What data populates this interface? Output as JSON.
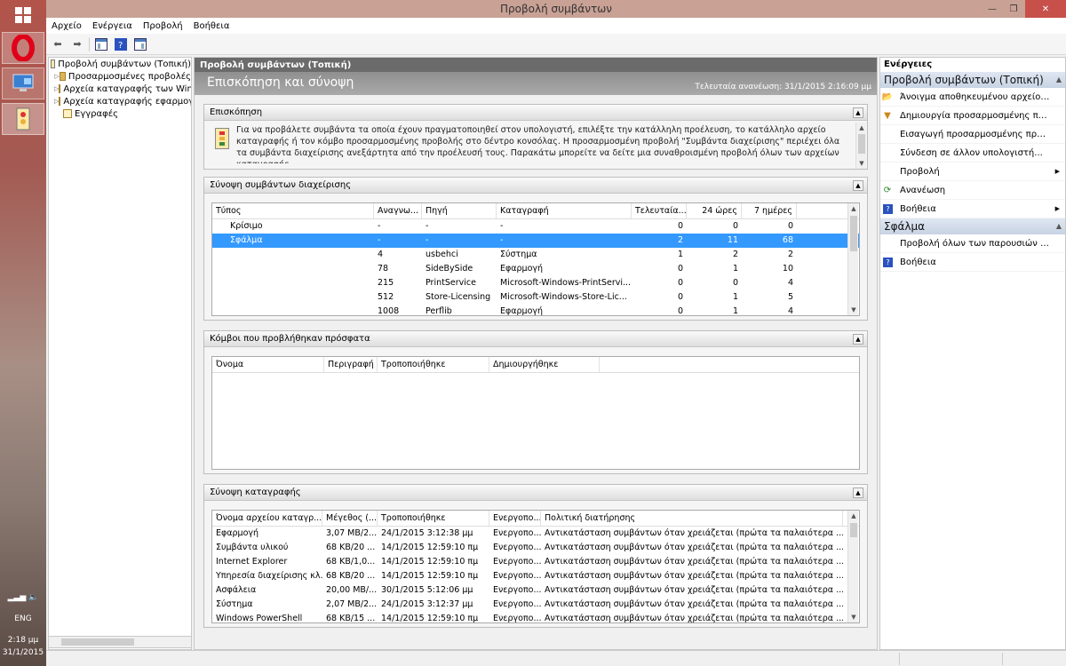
{
  "window": {
    "title": "Προβολή συμβάντων",
    "minimize": "—",
    "restore": "❐",
    "close": "✕"
  },
  "menu": [
    "Αρχείο",
    "Ενέργεια",
    "Προβολή",
    "Βοήθεια"
  ],
  "taskbar": {
    "language": "ENG",
    "time": "2:18 μμ",
    "date": "31/1/2015"
  },
  "tree": [
    {
      "label": "Προβολή συμβάντων (Τοπική)",
      "expander": ""
    },
    {
      "label": "Προσαρμοσμένες προβολές",
      "expander": "▷"
    },
    {
      "label": "Αρχεία καταγραφής των Windows",
      "expander": "▷"
    },
    {
      "label": "Αρχεία καταγραφής εφαρμογών",
      "expander": "▷"
    },
    {
      "label": "Εγγραφές",
      "expander": ""
    }
  ],
  "center": {
    "header": "Προβολή συμβάντων (Τοπική)",
    "banner_title": "Επισκόπηση και σύνοψη",
    "last_update": "Τελευταία ανανέωση: 31/1/2015 2:16:09 μμ",
    "overview": {
      "title": "Επισκόπηση",
      "text": "Για να προβάλετε συμβάντα τα οποία έχουν πραγματοποιηθεί στον υπολογιστή, επιλέξτε την κατάλληλη προέλευση, το κατάλληλο αρχείο καταγραφής ή τον κόμβο προσαρμοσμένης προβολής στο δέντρο κονσόλας. Η προσαρμοσμένη προβολή \"Συμβάντα διαχείρισης\" περιέχει όλα τα συμβάντα διαχείρισης ανεξάρτητα από την προέλευσή τους. Παρακάτω μπορείτε να δείτε μια συναθροισμένη προβολή όλων των αρχείων καταγραφής."
    },
    "summary": {
      "title": "Σύνοψη συμβάντων διαχείρισης",
      "columns": [
        "Τύπος",
        "Αναγνω...",
        "Πηγή",
        "Καταγραφή",
        "Τελευταία...",
        "24 ώρες",
        "7 ημέρες"
      ],
      "rows": [
        {
          "type": "Κρίσιμο",
          "id": "-",
          "source": "-",
          "log": "-",
          "hour": "0",
          "day": "0",
          "week": "0"
        },
        {
          "type": "Σφάλμα",
          "id": "-",
          "source": "-",
          "log": "-",
          "hour": "2",
          "day": "11",
          "week": "68"
        },
        {
          "type": "",
          "id": "4",
          "source": "usbehci",
          "log": "Σύστημα",
          "hour": "1",
          "day": "2",
          "week": "2"
        },
        {
          "type": "",
          "id": "78",
          "source": "SideBySide",
          "log": "Εφαρμογή",
          "hour": "0",
          "day": "1",
          "week": "10"
        },
        {
          "type": "",
          "id": "215",
          "source": "PrintService",
          "log": "Microsoft-Windows-PrintServi...",
          "hour": "0",
          "day": "0",
          "week": "4"
        },
        {
          "type": "",
          "id": "512",
          "source": "Store-Licensing",
          "log": "Microsoft-Windows-Store-Lic...",
          "hour": "0",
          "day": "1",
          "week": "5"
        },
        {
          "type": "",
          "id": "1008",
          "source": "Perflib",
          "log": "Εφαρμογή",
          "hour": "0",
          "day": "1",
          "week": "4"
        }
      ]
    },
    "recent": {
      "title": "Κόμβοι που προβλήθηκαν πρόσφατα",
      "columns": [
        "Όνομα",
        "Περιγραφή",
        "Τροποποιήθηκε",
        "Δημιουργήθηκε"
      ]
    },
    "logsum": {
      "title": "Σύνοψη καταγραφής",
      "columns": [
        "Όνομα αρχείου καταγρ...",
        "Μέγεθος (...",
        "Τροποποιήθηκε",
        "Ενεργοπο...",
        "Πολιτική διατήρησης"
      ],
      "rows": [
        {
          "name": "Εφαρμογή",
          "size": "3,07 MB/2...",
          "mod": "24/1/2015 3:12:38 μμ",
          "en": "Ενεργοπο...",
          "pol": "Αντικατάσταση συμβάντων όταν χρειάζεται (πρώτα τα παλαιότερα ..."
        },
        {
          "name": "Συμβάντα υλικού",
          "size": "68 KB/20 ...",
          "mod": "14/1/2015 12:59:10 πμ",
          "en": "Ενεργοπο...",
          "pol": "Αντικατάσταση συμβάντων όταν χρειάζεται (πρώτα τα παλαιότερα ..."
        },
        {
          "name": "Internet Explorer",
          "size": "68 KB/1,0...",
          "mod": "14/1/2015 12:59:10 πμ",
          "en": "Ενεργοπο...",
          "pol": "Αντικατάσταση συμβάντων όταν χρειάζεται (πρώτα τα παλαιότερα ..."
        },
        {
          "name": "Υπηρεσία διαχείρισης κλ...",
          "size": "68 KB/20 ...",
          "mod": "14/1/2015 12:59:10 πμ",
          "en": "Ενεργοπο...",
          "pol": "Αντικατάσταση συμβάντων όταν χρειάζεται (πρώτα τα παλαιότερα ..."
        },
        {
          "name": "Ασφάλεια",
          "size": "20,00 MB/...",
          "mod": "30/1/2015 5:12:06 μμ",
          "en": "Ενεργοπο...",
          "pol": "Αντικατάσταση συμβάντων όταν χρειάζεται (πρώτα τα παλαιότερα ..."
        },
        {
          "name": "Σύστημα",
          "size": "2,07 MB/2...",
          "mod": "24/1/2015 3:12:37 μμ",
          "en": "Ενεργοπο...",
          "pol": "Αντικατάσταση συμβάντων όταν χρειάζεται (πρώτα τα παλαιότερα ..."
        },
        {
          "name": "Windows PowerShell",
          "size": "68 KB/15 ...",
          "mod": "14/1/2015 12:59:10 πμ",
          "en": "Ενεργοπο...",
          "pol": "Αντικατάσταση συμβάντων όταν χρειάζεται (πρώτα τα παλαιότερα ..."
        }
      ]
    }
  },
  "actions": {
    "title": "Ενέργειες",
    "group1": "Προβολή συμβάντων (Τοπική)",
    "items1": [
      {
        "label": "Άνοιγμα αποθηκευμένου αρχείου κ...",
        "icon": "📂",
        "iconName": "folder-open-icon",
        "sub": ""
      },
      {
        "label": "Δημιουργία προσαρμοσμένης προ...",
        "icon": "▼",
        "iconName": "filter-icon",
        "sub": ""
      },
      {
        "label": "Εισαγωγή προσαρμοσμένης προβ...",
        "icon": "",
        "iconName": "",
        "sub": ""
      },
      {
        "label": "Σύνδεση σε άλλον υπολογιστή...",
        "icon": "",
        "iconName": "",
        "sub": ""
      },
      {
        "label": "Προβολή",
        "icon": "",
        "iconName": "",
        "sub": "▶"
      },
      {
        "label": "Ανανέωση",
        "icon": "⟳",
        "iconName": "refresh-icon",
        "sub": ""
      },
      {
        "label": "Βοήθεια",
        "icon": "?",
        "iconName": "help-icon",
        "sub": "▶"
      }
    ],
    "group2": "Σφάλμα",
    "items2": [
      {
        "label": "Προβολή όλων των παρουσιών α...",
        "icon": "",
        "iconName": "",
        "sub": ""
      },
      {
        "label": "Βοήθεια",
        "icon": "?",
        "iconName": "help-icon",
        "sub": ""
      }
    ]
  }
}
